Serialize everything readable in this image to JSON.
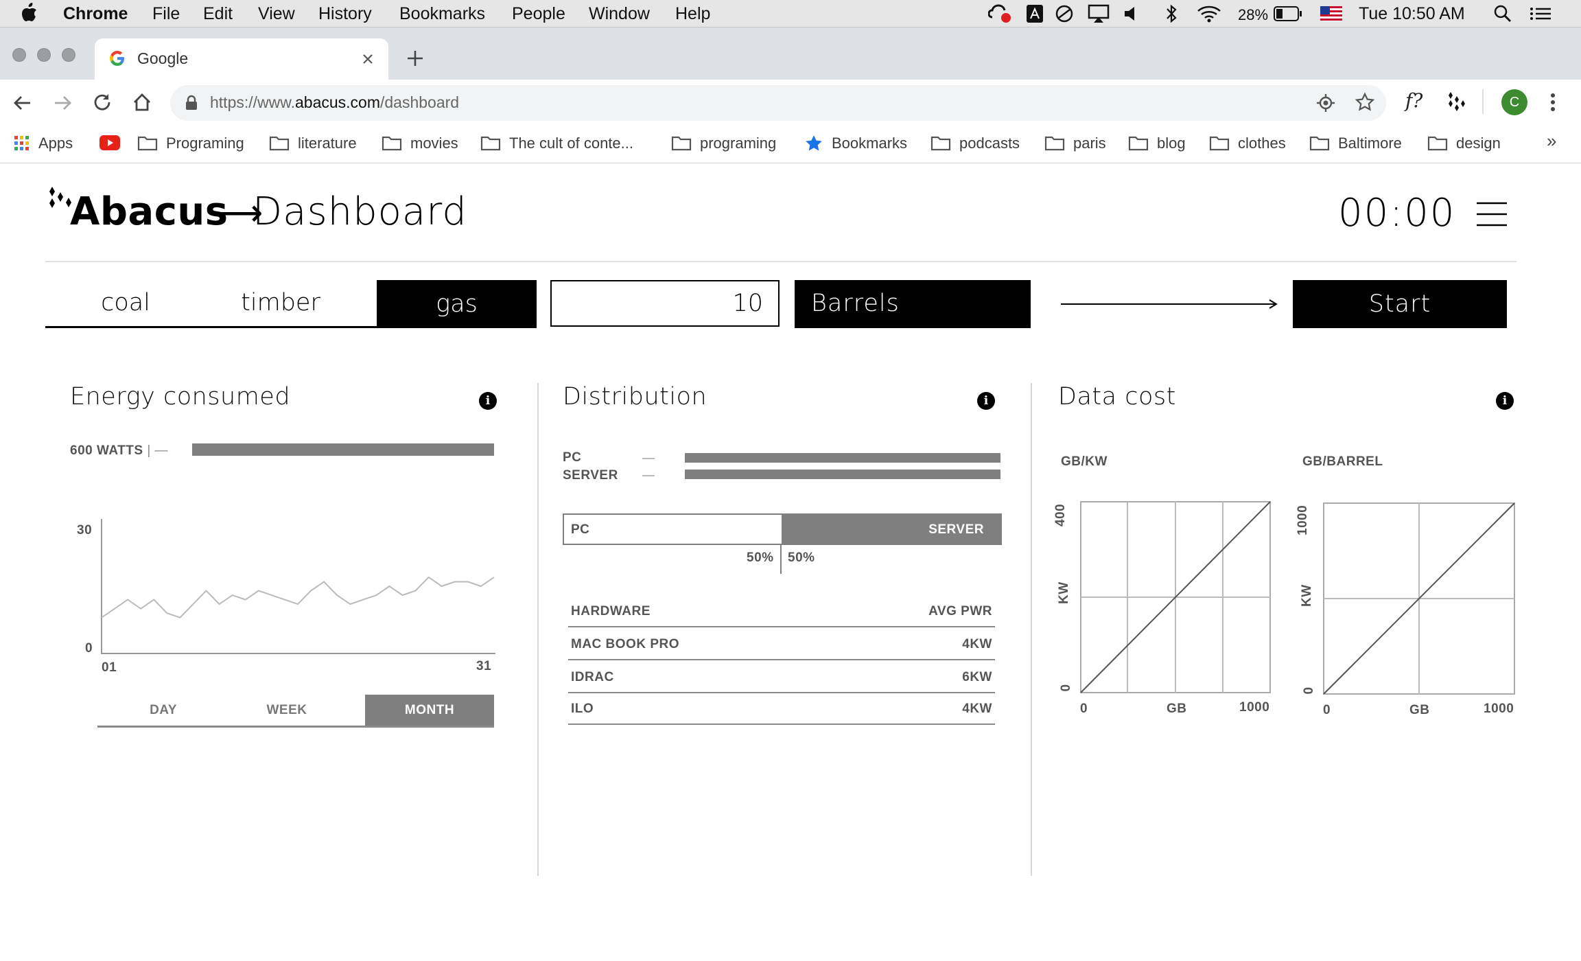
{
  "menubar": {
    "app": "Chrome",
    "items": [
      "File",
      "Edit",
      "View",
      "History",
      "Bookmarks",
      "People",
      "Window",
      "Help"
    ],
    "battery": "28%",
    "clock": "Tue 10:50 AM"
  },
  "browser": {
    "tab_title": "Google",
    "url_prefix": "https://www.",
    "url_domain": "abacus.com",
    "url_path": "/dashboard",
    "profile_initial": "C",
    "ext_fx_label": "f?",
    "bookmarks": [
      "Apps",
      "Programing",
      "literature",
      "movies",
      "The cult of conte...",
      "programing",
      "Bookmarks",
      "podcasts",
      "paris",
      "blog",
      "clothes",
      "Baltimore",
      "design"
    ],
    "bookmarks_overflow": "»"
  },
  "header": {
    "brand": "Abacus",
    "arrow": "⟶",
    "page": "Dashboard",
    "timer": "00:00"
  },
  "controls": {
    "resources": [
      "coal",
      "timber",
      "gas"
    ],
    "selected_resource": "gas",
    "quantity": "10",
    "unit": "Barrels",
    "start_label": "Start"
  },
  "energy": {
    "title": "Energy consumed",
    "watts_label": "600 WATTS",
    "watts_sep": "| —",
    "y_max": "30",
    "y_min": "0",
    "x_start": "01",
    "x_end": "31",
    "ranges": [
      "DAY",
      "WEEK",
      "MONTH"
    ],
    "selected_range": "MONTH"
  },
  "distribution": {
    "title": "Distribution",
    "legend": [
      "PC",
      "SERVER"
    ],
    "split_left": "PC",
    "split_right": "SERVER",
    "pct_left": "50%",
    "pct_right": "50%",
    "table_headers": [
      "HARDWARE",
      "AVG PWR"
    ],
    "rows": [
      {
        "hardware": "MAC BOOK PRO",
        "avg_pwr": "4KW"
      },
      {
        "hardware": "IDRAC",
        "avg_pwr": "6KW"
      },
      {
        "hardware": "ILO",
        "avg_pwr": "4KW"
      }
    ]
  },
  "data_cost": {
    "title": "Data cost",
    "charts": [
      {
        "label": "GB/KW",
        "y_axis": "KW",
        "y_max": "400",
        "y_min": "0",
        "x_min": "0",
        "x_mid": "GB",
        "x_max": "1000"
      },
      {
        "label": "GB/BARREL",
        "y_axis": "KW",
        "y_max": "1000",
        "y_min": "0",
        "x_min": "0",
        "x_mid": "GB",
        "x_max": "1000"
      }
    ]
  },
  "chart_data": [
    {
      "type": "line",
      "x": [
        1,
        2,
        3,
        4,
        5,
        6,
        7,
        8,
        9,
        10,
        11,
        12,
        13,
        14,
        15,
        16,
        17,
        18,
        19,
        20,
        21,
        22,
        23,
        24,
        25,
        26,
        27,
        28,
        29,
        30,
        31
      ],
      "series": [
        {
          "values": [
            8,
            10,
            12,
            10,
            12,
            9,
            8,
            11,
            14,
            11,
            13,
            12,
            14,
            13,
            12,
            11,
            14,
            16,
            13,
            11,
            12,
            13,
            15,
            13,
            14,
            17,
            15,
            16,
            16,
            15,
            17
          ]
        }
      ],
      "xlim": [
        1,
        31
      ],
      "ylim": [
        0,
        30
      ]
    },
    {
      "type": "line",
      "x": [
        0,
        1000
      ],
      "series": [
        {
          "values": [
            0,
            400
          ]
        }
      ],
      "xlim": [
        0,
        1000
      ],
      "ylim": [
        0,
        400
      ]
    },
    {
      "type": "line",
      "x": [
        0,
        1000
      ],
      "series": [
        {
          "values": [
            0,
            1000
          ]
        }
      ],
      "xlim": [
        0,
        1000
      ],
      "ylim": [
        0,
        1000
      ]
    }
  ]
}
